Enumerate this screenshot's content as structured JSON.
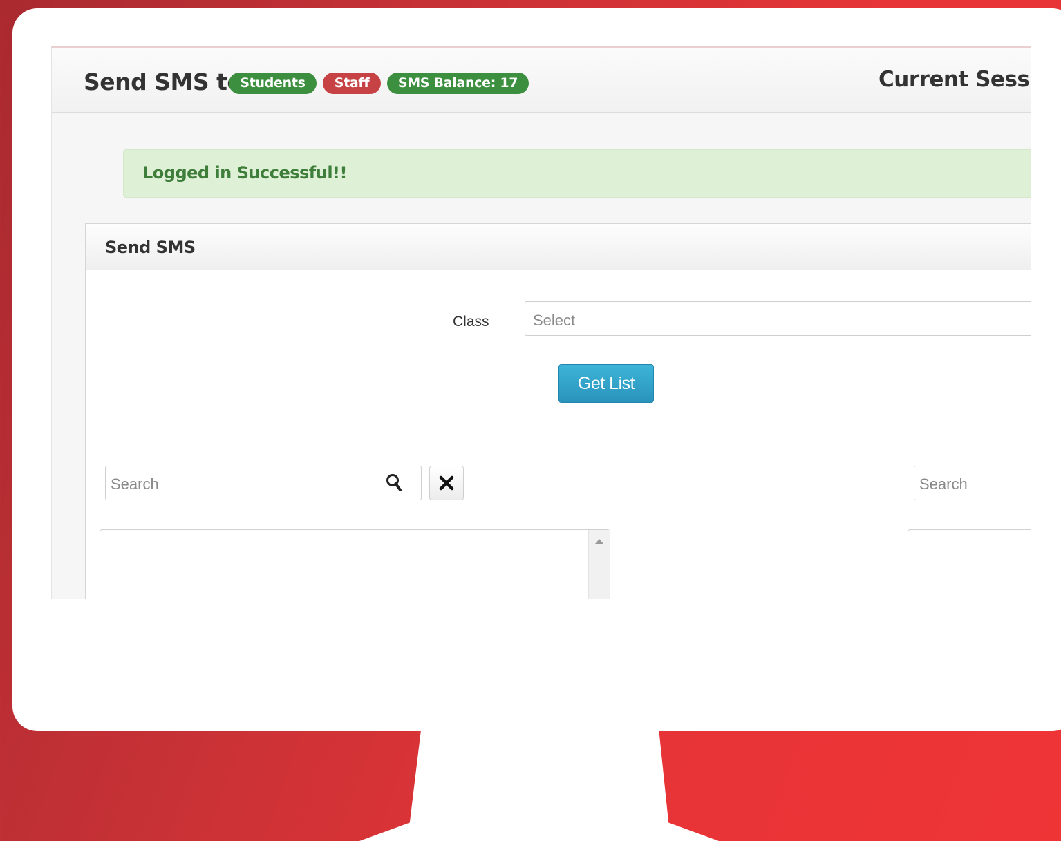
{
  "header": {
    "title": "Send SMS to",
    "badges": {
      "students": "Students",
      "staff": "Staff",
      "balance": "SMS Balance: 17"
    },
    "session": "Current Sessi"
  },
  "alert": {
    "message": "Logged in Successful!!"
  },
  "panel": {
    "title": "Send SMS",
    "class_label": "Class",
    "class_select_value": "Select",
    "get_list_label": "Get List",
    "left_search_placeholder": "Search",
    "right_search_placeholder": "Search"
  },
  "colors": {
    "badge_green": "#3c8f3f",
    "badge_red": "#c64244",
    "primary_button": "#2a93bb",
    "alert_bg": "#def0d6",
    "alert_text": "#3e7d3a",
    "background_red": "#e63437"
  },
  "icons": [
    "search-icon",
    "close-icon",
    "scroll-up-arrow-icon"
  ]
}
